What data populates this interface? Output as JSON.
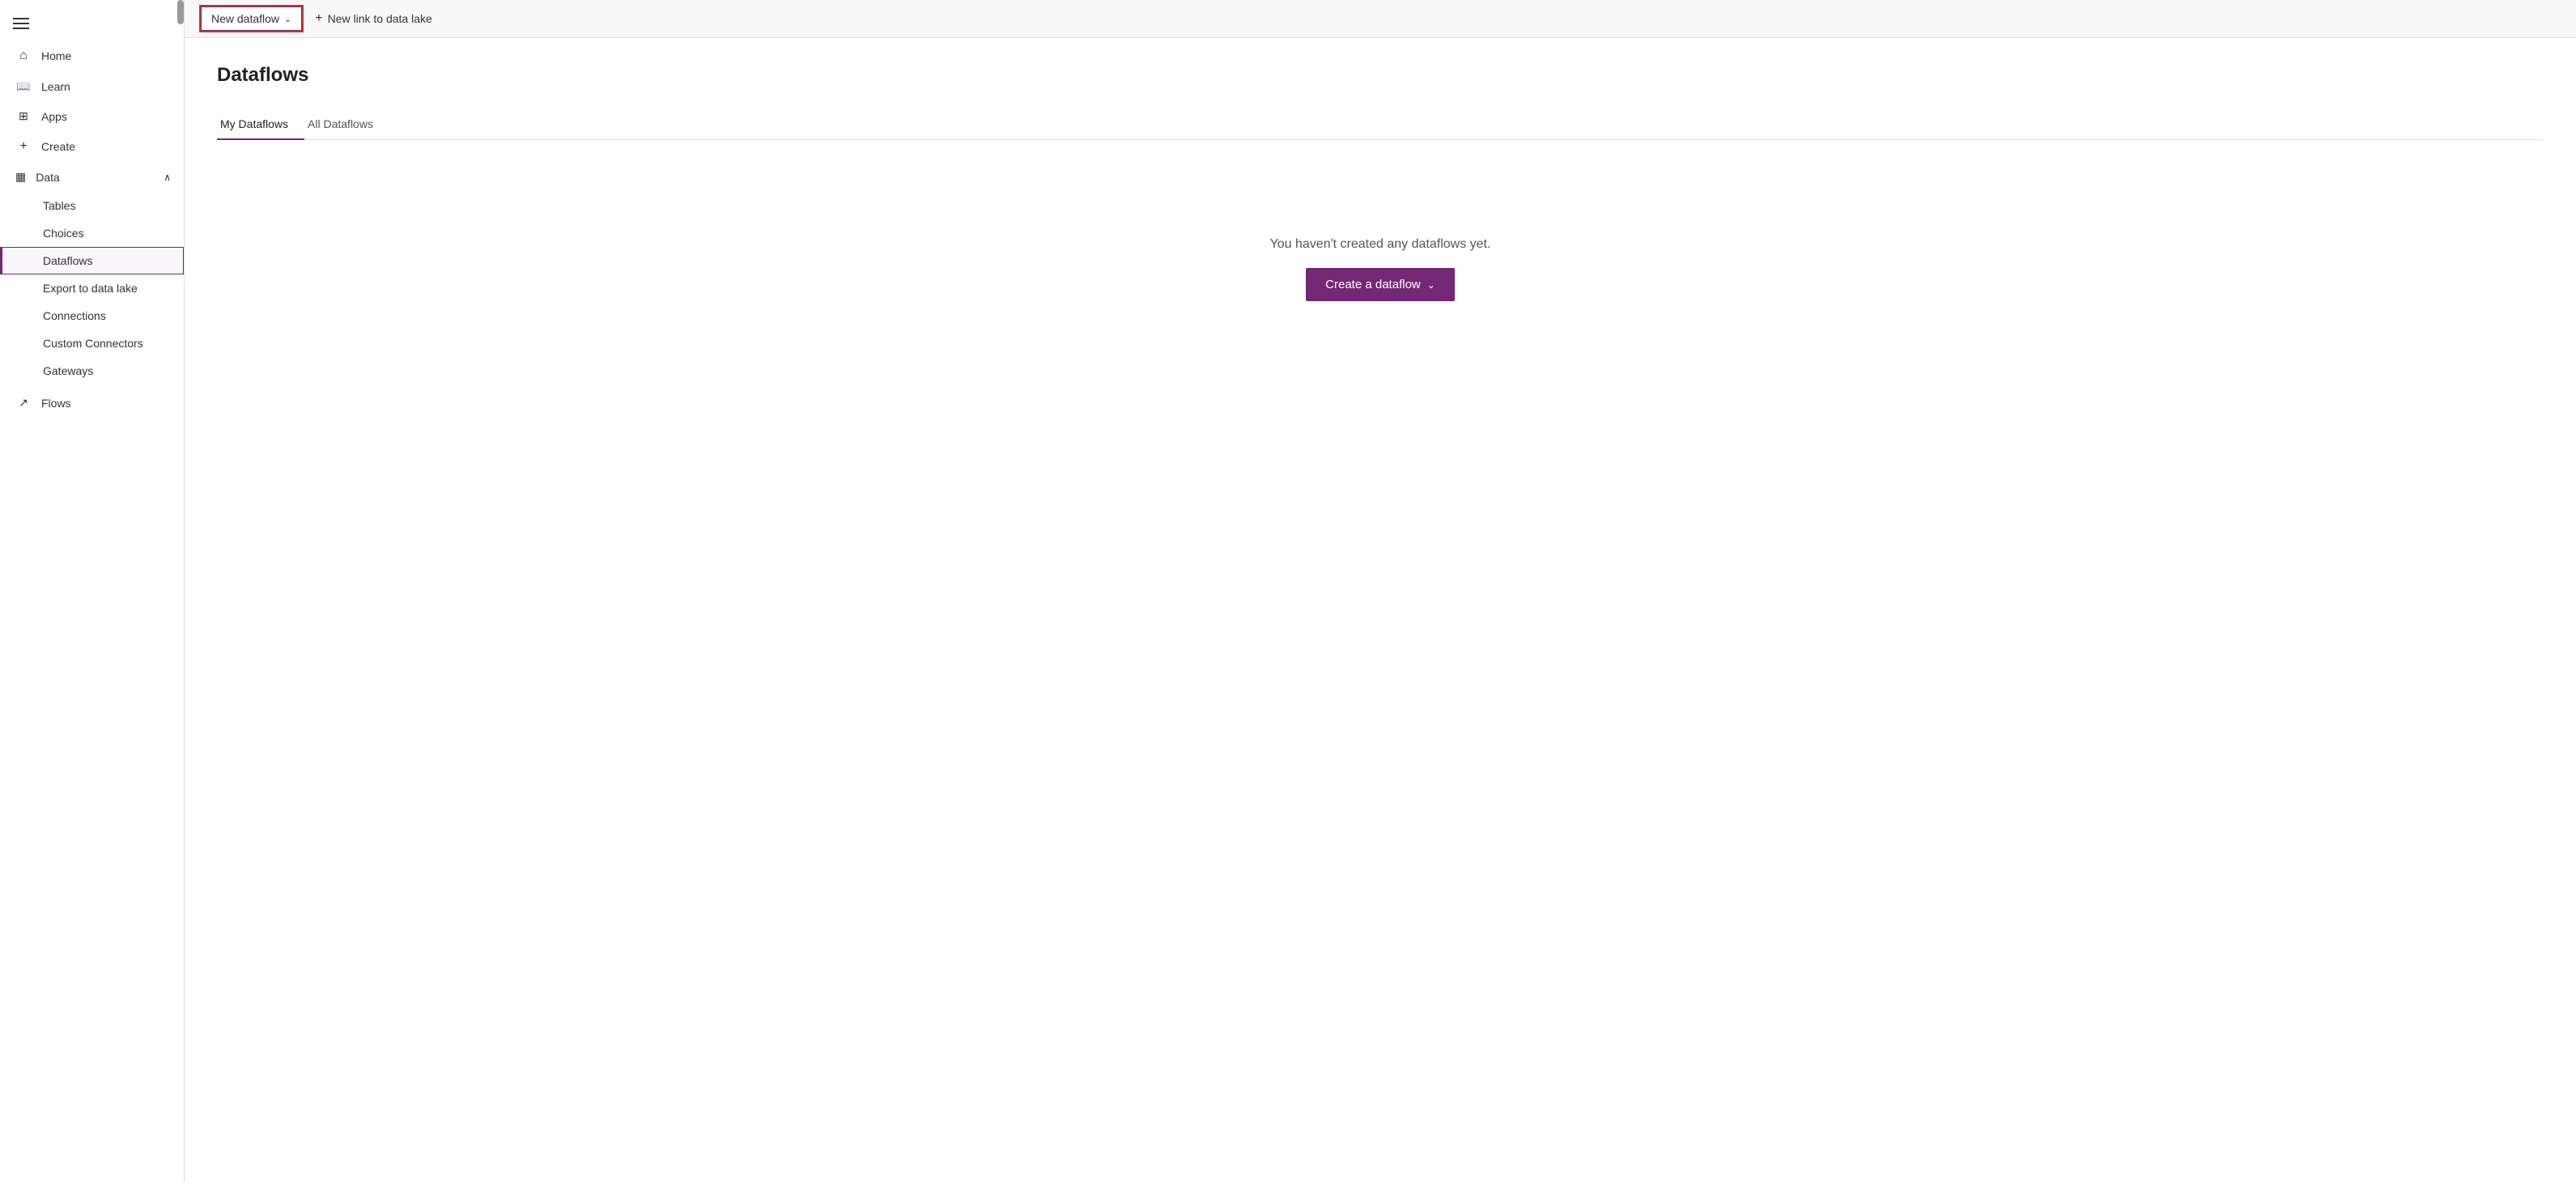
{
  "sidebar": {
    "hamburger_label": "Menu",
    "items": [
      {
        "id": "home",
        "label": "Home",
        "icon": "⌂"
      },
      {
        "id": "learn",
        "label": "Learn",
        "icon": "📖"
      },
      {
        "id": "apps",
        "label": "Apps",
        "icon": "+"
      },
      {
        "id": "create",
        "label": "Create",
        "icon": "+"
      },
      {
        "id": "data",
        "label": "Data",
        "icon": "▦",
        "expandable": true,
        "expanded": true
      }
    ],
    "data_sub_items": [
      {
        "id": "tables",
        "label": "Tables"
      },
      {
        "id": "choices",
        "label": "Choices"
      },
      {
        "id": "dataflows",
        "label": "Dataflows",
        "active": true
      },
      {
        "id": "export-to-data-lake",
        "label": "Export to data lake"
      },
      {
        "id": "connections",
        "label": "Connections"
      },
      {
        "id": "custom-connectors",
        "label": "Custom Connectors"
      },
      {
        "id": "gateways",
        "label": "Gateways"
      }
    ],
    "bottom_items": [
      {
        "id": "flows",
        "label": "Flows",
        "icon": "↗"
      }
    ]
  },
  "toolbar": {
    "new_dataflow_label": "New dataflow",
    "new_link_label": "New link to data lake"
  },
  "main": {
    "page_title": "Dataflows",
    "tabs": [
      {
        "id": "my-dataflows",
        "label": "My Dataflows",
        "active": true
      },
      {
        "id": "all-dataflows",
        "label": "All Dataflows",
        "active": false
      }
    ],
    "empty_state_text": "You haven't created any dataflows yet.",
    "create_button_label": "Create a dataflow"
  }
}
